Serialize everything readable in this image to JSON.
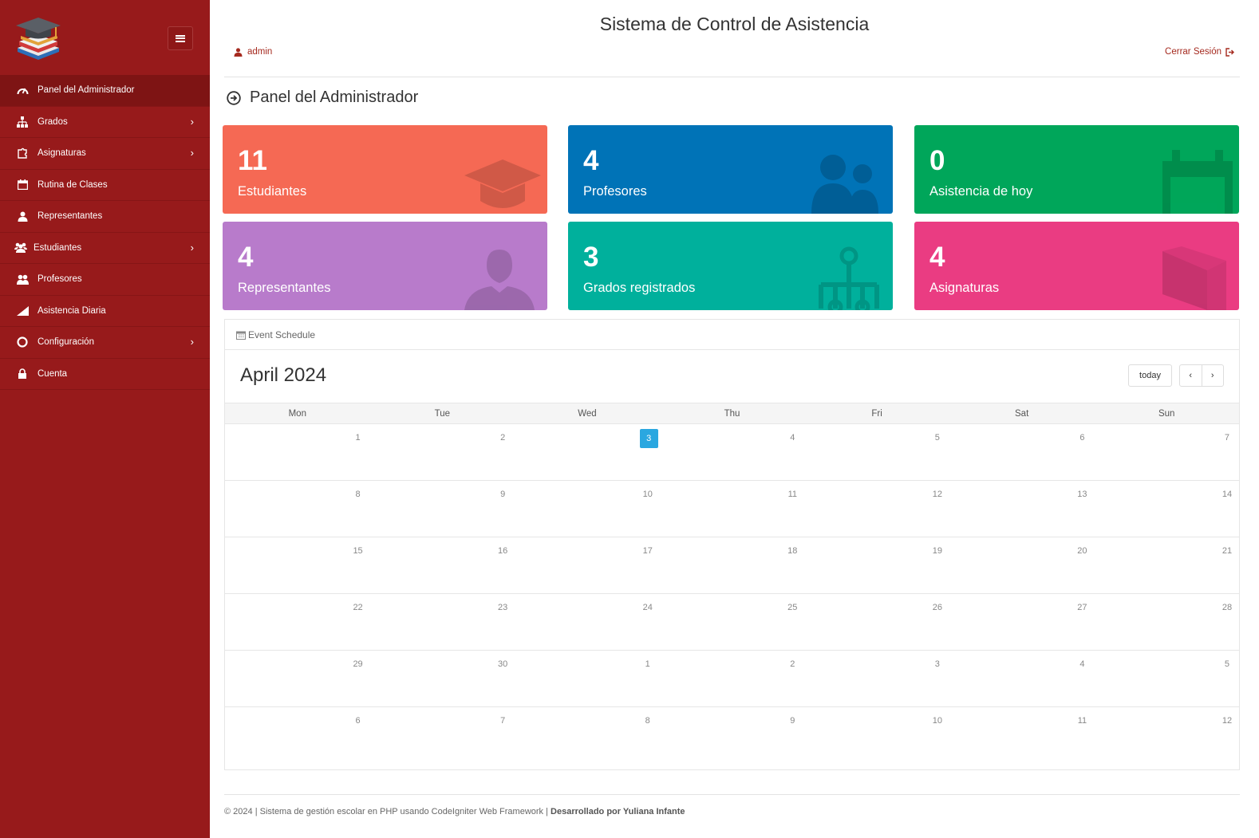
{
  "header": {
    "title": "Sistema de Control de Asistencia",
    "user": "admin",
    "logout": "Cerrar Sesión"
  },
  "sidebar": {
    "items": [
      {
        "label": "Panel del Administrador",
        "icon": "dashboard-icon",
        "active": true
      },
      {
        "label": "Grados",
        "icon": "sitemap-icon",
        "chevron": true
      },
      {
        "label": "Asignaturas",
        "icon": "puzzle-icon",
        "chevron": true
      },
      {
        "label": "Rutina de Clases",
        "icon": "calendar-icon"
      },
      {
        "label": "Representantes",
        "icon": "user-icon"
      },
      {
        "label": "Estudiantes",
        "icon": "users-icon",
        "chevron": true
      },
      {
        "label": "Profesores",
        "icon": "user-group-icon"
      },
      {
        "label": "Asistencia Diaria",
        "icon": "chart-icon"
      },
      {
        "label": "Configuración",
        "icon": "lifebuoy-icon",
        "chevron": true
      },
      {
        "label": "Cuenta",
        "icon": "lock-icon"
      }
    ]
  },
  "page": {
    "heading": "Panel del Administrador"
  },
  "cards": [
    {
      "value": "11",
      "label": "Estudiantes",
      "color": "#f56954",
      "icon": "graduation-cap-icon"
    },
    {
      "value": "4",
      "label": "Profesores",
      "color": "#0073b7",
      "icon": "users-icon"
    },
    {
      "value": "0",
      "label": "Asistencia de hoy",
      "color": "#00a65a",
      "icon": "calendar-icon"
    },
    {
      "value": "4",
      "label": "Representantes",
      "color": "#b87bcb",
      "icon": "user-icon"
    },
    {
      "value": "3",
      "label": "Grados registrados",
      "color": "#00b09c",
      "icon": "sitemap-icon"
    },
    {
      "value": "4",
      "label": "Asignaturas",
      "color": "#ea3c82",
      "icon": "book-icon"
    }
  ],
  "calendar": {
    "panel_title": "Event Schedule",
    "month": "April 2024",
    "today_label": "today",
    "prev_label": "‹",
    "next_label": "›",
    "days_of_week": [
      "Mon",
      "Tue",
      "Wed",
      "Thu",
      "Fri",
      "Sat",
      "Sun"
    ],
    "weeks": [
      [
        "1",
        "2",
        "3",
        "4",
        "5",
        "6",
        "7"
      ],
      [
        "8",
        "9",
        "10",
        "11",
        "12",
        "13",
        "14"
      ],
      [
        "15",
        "16",
        "17",
        "18",
        "19",
        "20",
        "21"
      ],
      [
        "22",
        "23",
        "24",
        "25",
        "26",
        "27",
        "28"
      ],
      [
        "29",
        "30",
        "1",
        "2",
        "3",
        "4",
        "5"
      ],
      [
        "6",
        "7",
        "8",
        "9",
        "10",
        "11",
        "12"
      ]
    ],
    "today": "3"
  },
  "footer": {
    "text": "© 2024 | Sistema de gestión escolar en PHP usando CodeIgniter Web Framework | ",
    "author": "Desarrollado por Yuliana Infante"
  }
}
